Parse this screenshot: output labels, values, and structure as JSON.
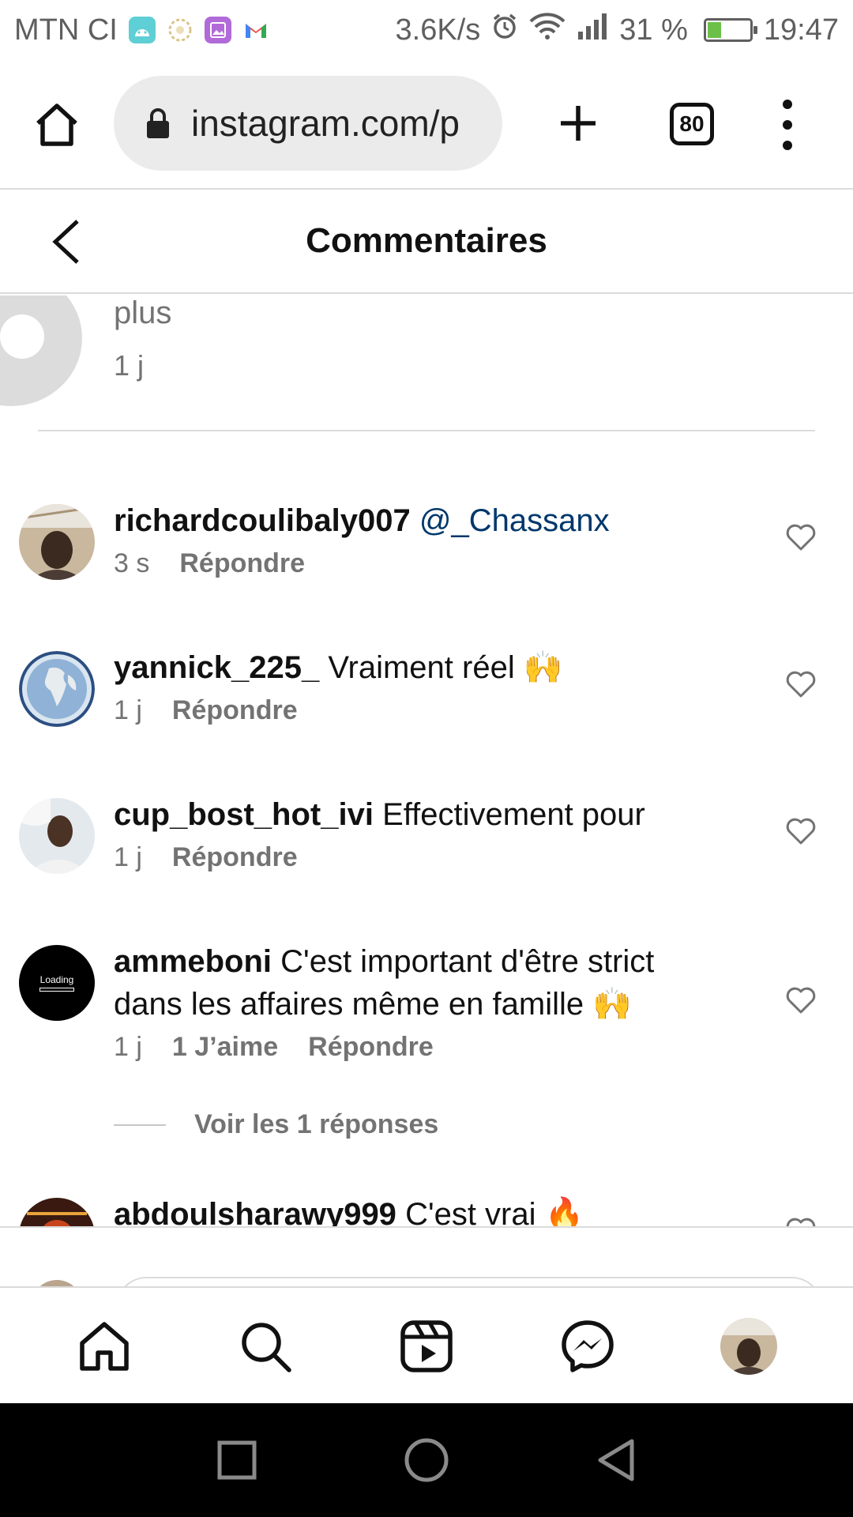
{
  "status_bar": {
    "carrier": "MTN CI",
    "net_speed": "3.6K/s",
    "battery_percent": "31 %",
    "battery_level": 0.31,
    "time": "19:47",
    "icons": [
      "android-app-icon",
      "laurel-icon",
      "gallery-icon",
      "gmail-icon",
      "alarm-icon",
      "wifi-icon",
      "signal-icon",
      "battery-charging-icon"
    ]
  },
  "browser": {
    "url": "instagram.com/p",
    "tab_count": "80",
    "icons": [
      "home-icon",
      "lock-icon",
      "plus-icon",
      "tabs-icon",
      "more-vert-icon"
    ]
  },
  "header": {
    "title": "Commentaires",
    "back_icon": "chevron-left-icon"
  },
  "previous_comment": {
    "text": "plus",
    "time": "1 j"
  },
  "comments": [
    {
      "username": "richardcoulibaly007",
      "mention": "@_Chassanx",
      "text": "",
      "time": "3 s",
      "likes": "",
      "reply": "Répondre"
    },
    {
      "username": "yannick_225_",
      "text": "Vraiment réel 🙌",
      "time": "1 j",
      "likes": "",
      "reply": "Répondre"
    },
    {
      "username": "cup_bost_hot_ivi",
      "text": "Effectivement pour",
      "time": "1 j",
      "likes": "",
      "reply": "Répondre"
    },
    {
      "username": "ammeboni",
      "text": "C'est important d'être strict dans les affaires même en famille 🙌",
      "time": "1 j",
      "likes": "1 J’aime",
      "reply": "Répondre",
      "avatar_text": "Loading",
      "view_replies": "Voir les 1 réponses"
    },
    {
      "username": "abdoulsharawy999",
      "text": "C'est vrai 🔥",
      "time": "",
      "likes": "",
      "reply": ""
    }
  ],
  "bottom_nav": [
    "home-icon",
    "search-icon",
    "reels-icon",
    "messenger-icon",
    "profile-avatar"
  ],
  "android_nav": [
    "recents-icon",
    "home-circle-icon",
    "back-triangle-icon"
  ],
  "colors": {
    "mention": "#00376b",
    "secondary_text": "#737373",
    "divider": "#dbdbdb"
  }
}
